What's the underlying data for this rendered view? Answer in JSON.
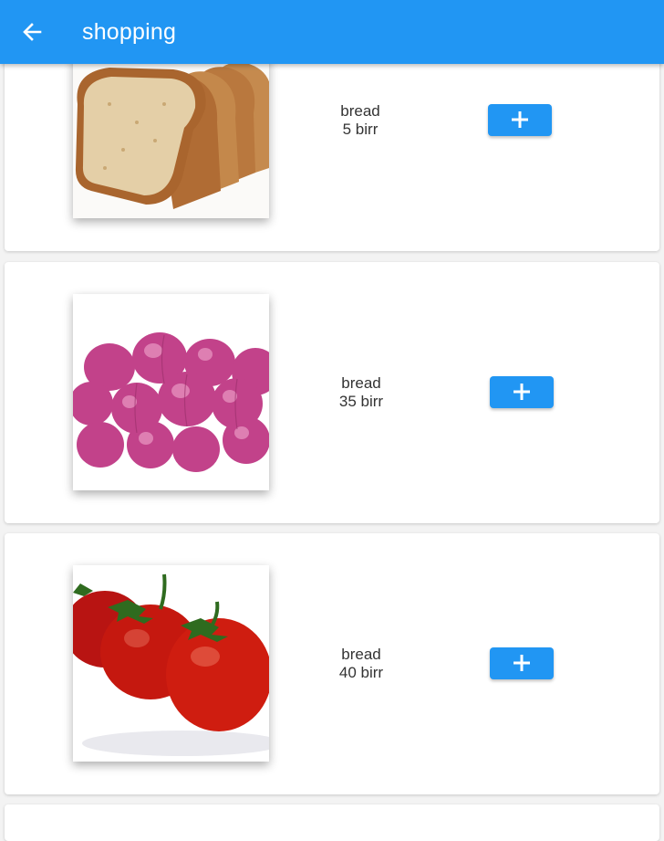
{
  "appbar": {
    "title": "shopping",
    "back_icon": "arrow-left-icon",
    "background": "#2196f3"
  },
  "products": [
    {
      "name": "bread",
      "price": "5 birr",
      "image": "bread slices photo",
      "add_icon": "plus-icon"
    },
    {
      "name": "bread",
      "price": "35 birr",
      "image": "red onions photo",
      "add_icon": "plus-icon"
    },
    {
      "name": "bread",
      "price": "40 birr",
      "image": "tomatoes photo",
      "add_icon": "plus-icon"
    }
  ],
  "colors": {
    "accent": "#2196f3",
    "card": "#ffffff",
    "background": "#f3f3f3"
  }
}
